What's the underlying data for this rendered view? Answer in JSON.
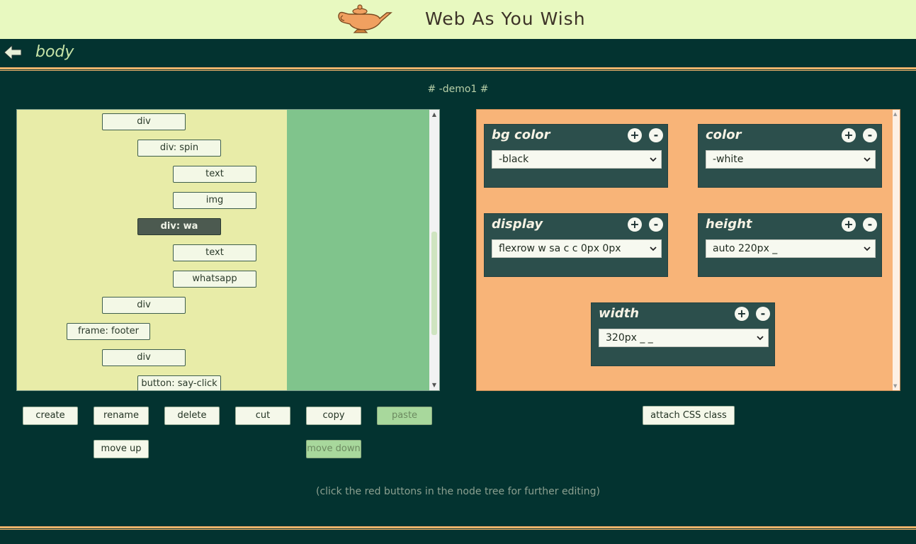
{
  "app": {
    "title": "Web As You Wish"
  },
  "nav": {
    "current_node": "body"
  },
  "demo_label": "# -demo1 #",
  "tree": {
    "nodes": [
      {
        "label": "div",
        "indent": 1
      },
      {
        "label": "div: spin",
        "indent": 2
      },
      {
        "label": "text",
        "indent": 3
      },
      {
        "label": "img",
        "indent": 3
      },
      {
        "label": "div: wa",
        "indent": 2,
        "selected": true
      },
      {
        "label": "text",
        "indent": 3
      },
      {
        "label": "whatsapp",
        "indent": 3
      },
      {
        "label": "div",
        "indent": 1
      },
      {
        "label": "frame: footer",
        "indent": 0
      },
      {
        "label": "div",
        "indent": 1
      },
      {
        "label": "button: say-click",
        "indent": 2
      }
    ]
  },
  "actions": {
    "create": "create",
    "rename": "rename",
    "delete": "delete",
    "cut": "cut",
    "copy": "copy",
    "paste": "paste",
    "move_up": "move up",
    "move_down": "move down"
  },
  "css_props": [
    {
      "title": "bg color",
      "value": "-black"
    },
    {
      "title": "color",
      "value": "-white"
    },
    {
      "title": "display",
      "value": "flexrow w sa c c 0px 0px"
    },
    {
      "title": "height",
      "value": "auto 220px _"
    },
    {
      "title": "width",
      "value": "320px _ _"
    }
  ],
  "attach_label": "attach CSS class",
  "hint": "(click the red buttons in the node tree for further editing)",
  "colors": {
    "background": "#033330",
    "header": "#e8f9c0",
    "accent": "#f4b46c",
    "tree_bg": "#e8eca8",
    "tree_green": "#80c48c",
    "css_panel": "#f8b478",
    "card": "#2c4f4c"
  }
}
